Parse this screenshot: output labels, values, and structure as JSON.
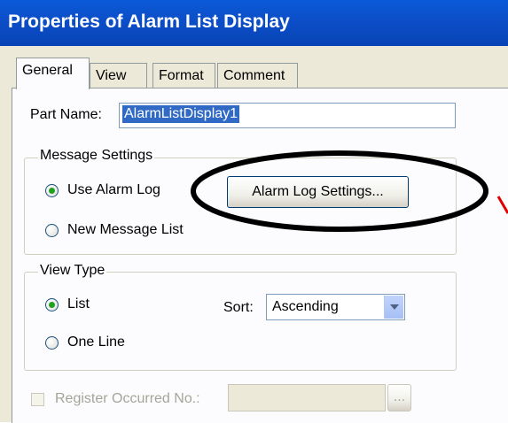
{
  "window": {
    "title": "Properties of Alarm List Display"
  },
  "tabs": [
    {
      "label": "General",
      "active": true
    },
    {
      "label": "View"
    },
    {
      "label": "Format"
    },
    {
      "label": "Comment"
    }
  ],
  "part_name": {
    "label": "Part Name:",
    "value": "AlarmListDisplay1"
  },
  "message_settings": {
    "title": "Message Settings",
    "options": [
      {
        "label": "Use Alarm Log",
        "selected": true
      },
      {
        "label": "New Message List",
        "selected": false
      }
    ],
    "button_label": "Alarm Log Settings..."
  },
  "view_type": {
    "title": "View Type",
    "options": [
      {
        "label": "List",
        "selected": true
      },
      {
        "label": "One Line",
        "selected": false
      }
    ],
    "sort_label": "Sort:",
    "sort_value": "Ascending"
  },
  "register": {
    "label": "Register Occurred No.:",
    "checked": false,
    "value": "",
    "browse_label": "..."
  },
  "annotation": {
    "color": "#000000",
    "pointer_color": "#e00000"
  }
}
